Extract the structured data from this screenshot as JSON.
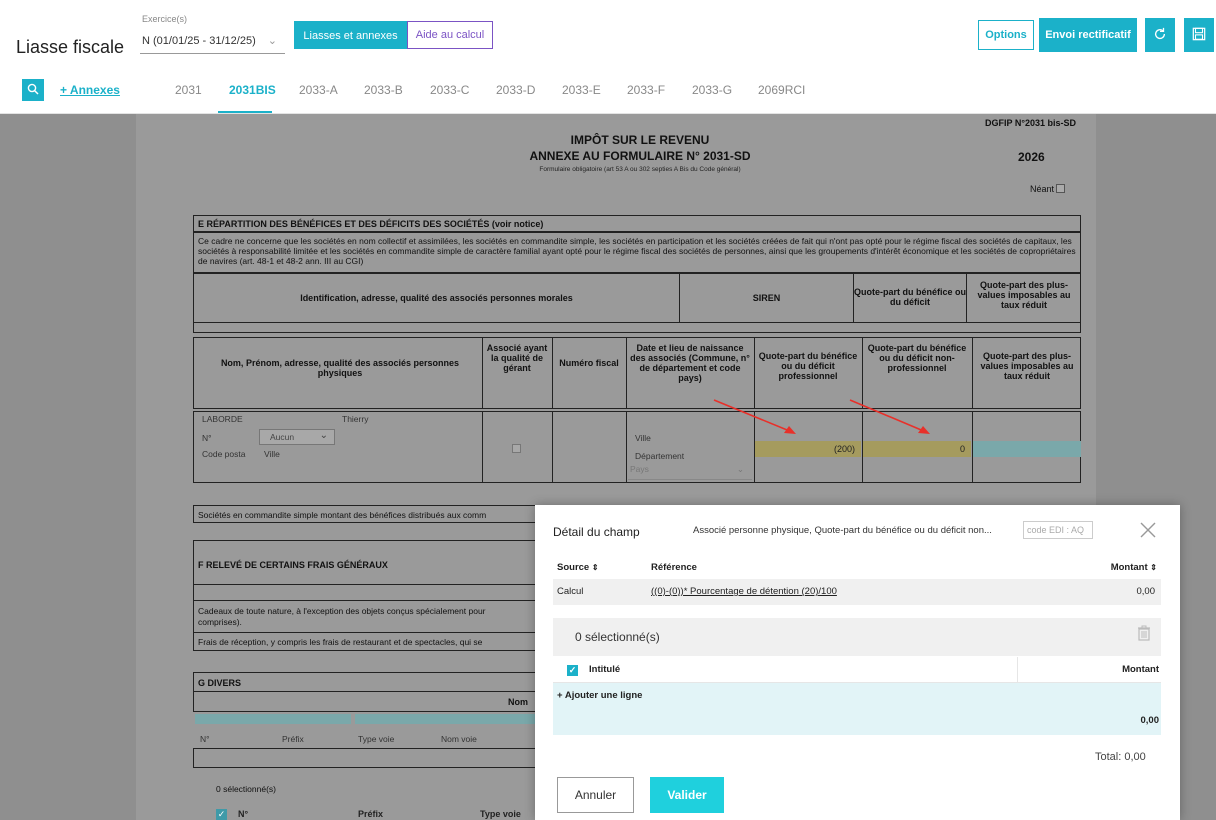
{
  "header": {
    "title": "Liasse fiscale",
    "exercise_label": "Exercice(s)",
    "exercise_value": "N (01/01/25 - 31/12/25)",
    "tab_liasses": "Liasses et annexes",
    "tab_aide": "Aide au calcul",
    "options_label": "Options",
    "envoi_label": "Envoi rectificatif"
  },
  "tabs": {
    "annexes_link": "+ Annexes",
    "items": [
      "2031",
      "2031BIS",
      "2033-A",
      "2033-B",
      "2033-C",
      "2033-D",
      "2033-E",
      "2033-F",
      "2033-G",
      "2069RCI"
    ],
    "active": "2031BIS"
  },
  "form": {
    "dgfip": "DGFIP N°2031 bis-SD",
    "title_line1": "IMPÔT SUR LE REVENU",
    "title_line2": "ANNEXE AU FORMULAIRE N° 2031-SD",
    "subtitle": "Formulaire obligatoire (art 53 A ou 302 septies A Bis du Code général)",
    "year": "2026",
    "neant": "Néant",
    "section_e_title": "E  RÉPARTITION DES BÉNÉFICES ET DES DÉFICITS DES SOCIÉTÉS (voir notice)",
    "section_e_text": "Ce cadre ne concerne que les sociétés en nom collectif et assimilées, les sociétés en commandite simple, les sociétés en participation et les sociétés créées de fait qui n'ont pas opté pour le régime fiscal des sociétés de capitaux, les sociétés à responsabilité limitée et les sociétés en commandite simple de caractère familial ayant opté pour le régime fiscal des sociétés de personnes, ainsi que les groupements d'intérêt économique et les sociétés de copropriétaires de navires (art. 48-1 et 48-2 ann. III au CGI)",
    "pm_headers": [
      "Identification, adresse, qualité des associés personnes morales",
      "SIREN",
      "Quote-part du bénéfice ou du déficit",
      "Quote-part des plus-values imposables au taux réduit"
    ],
    "pp_headers": [
      "Nom, Prénom, adresse, qualité des associés personnes physiques",
      "Associé ayant la qualité de gérant",
      "Numéro fiscal",
      "Date et lieu de naissance des associés (Commune, n° de département et code pays)",
      "Quote-part du bénéfice ou du déficit professionnel",
      "Quote-part du bénéfice ou du déficit non-professionnel",
      "Quote-part des plus-values imposables au taux réduit"
    ],
    "person": {
      "last_name": "LABORDE",
      "first_name": "Thierry",
      "num_label": "N°",
      "num_select": "Aucun",
      "postal_label": "Code posta",
      "city": "Ville",
      "birth_city": "Ville",
      "birth_dept": "Département",
      "birth_country": "Pays",
      "pro_value": "(200)",
      "nonpro_value": "0"
    },
    "commandite_text": "Sociétés en commandite simple montant des bénéfices distribués aux comm",
    "section_f_title": "F  RELEVÉ DE CERTAINS FRAIS GÉNÉRAUX",
    "f_text1": "Cadeaux de toute nature, à l'exception des objets conçus spécialement pour",
    "f_text1b": "comprises).",
    "f_text2": "Frais de réception, y compris les frais de restaurant et de spectacles, qui se",
    "section_g_title": "G  DIVERS",
    "g_nom": "Nom",
    "g_addr": [
      "N°",
      "Préfix",
      "Type voie",
      "Nom voie"
    ],
    "g_selected": "0 sélectionné(s)",
    "g_cols": [
      "N°",
      "Préfix",
      "Type voie"
    ]
  },
  "modal": {
    "title": "Détail du champ",
    "description": "Associé personne physique, Quote-part du bénéfice ou du déficit non...",
    "edi_placeholder": "code EDI : AQ",
    "col_source": "Source",
    "col_reference": "Référence",
    "col_montant": "Montant",
    "row_source": "Calcul",
    "row_reference": "((0)-(0))* Pourcentage de détention (20)/100",
    "row_montant": "0,00",
    "selected": "0 sélectionné(s)",
    "list_intitule": "Intitulé",
    "list_montant": "Montant",
    "add_line": "+ Ajouter une ligne",
    "add_montant": "0,00",
    "total": "Total: 0,00",
    "cancel": "Annuler",
    "validate": "Valider"
  },
  "colors": {
    "accent": "#1bb1c9",
    "purple": "#7b53c4",
    "overlay": "#8f8f8f"
  }
}
